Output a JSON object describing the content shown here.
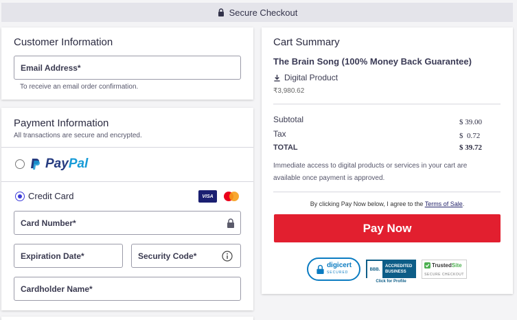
{
  "header": {
    "title": "Secure Checkout"
  },
  "customer": {
    "title": "Customer Information",
    "email_label": "Email Address*",
    "email_hint": "To receive an email order confirmation."
  },
  "payment": {
    "title": "Payment Information",
    "subtitle": "All transactions are secure and encrypted.",
    "paypal": {
      "text_1": "Pay",
      "text_2": "Pal"
    },
    "credit_card_label": "Credit Card",
    "visa_label": "VISA",
    "card_number_label": "Card Number*",
    "expiration_label": "Expiration Date*",
    "security_code_label": "Security Code*",
    "cardholder_label": "Cardholder Name*"
  },
  "cart": {
    "title": "Cart Summary",
    "product_name": "The Brain Song (100% Money Back Guarantee)",
    "product_type": "Digital Product",
    "product_price": "₹3,980.62",
    "subtotal_label": "Subtotal",
    "subtotal_value": "$ 39.00",
    "tax_label": "Tax",
    "tax_value": "$  0.72",
    "total_label": "TOTAL",
    "total_value": "$ 39.72",
    "notice": "Immediate access to digital products or services in your cart are available once payment is approved.",
    "agree_prefix": "By clicking Pay Now below, I agree to the ",
    "terms_link": "Terms of Sale",
    "agree_suffix": ".",
    "pay_button": "Pay Now"
  },
  "trust": {
    "digicert": "digicert",
    "digicert_sub": "SECURED",
    "bbb_line1": "ACCREDITED",
    "bbb_line2": "BUSINESS",
    "bbb_mark": "BBB.",
    "bbb_link": "Click for Profile",
    "trustedsite_1": "Trusted",
    "trustedsite_2": "Site",
    "trustedsite_sub": "SECURE CHECKOUT"
  },
  "colors": {
    "accent": "#3b3bd9",
    "pay_button": "#e21f2f",
    "paypal_dark": "#253b80",
    "paypal_light": "#179bd7"
  }
}
